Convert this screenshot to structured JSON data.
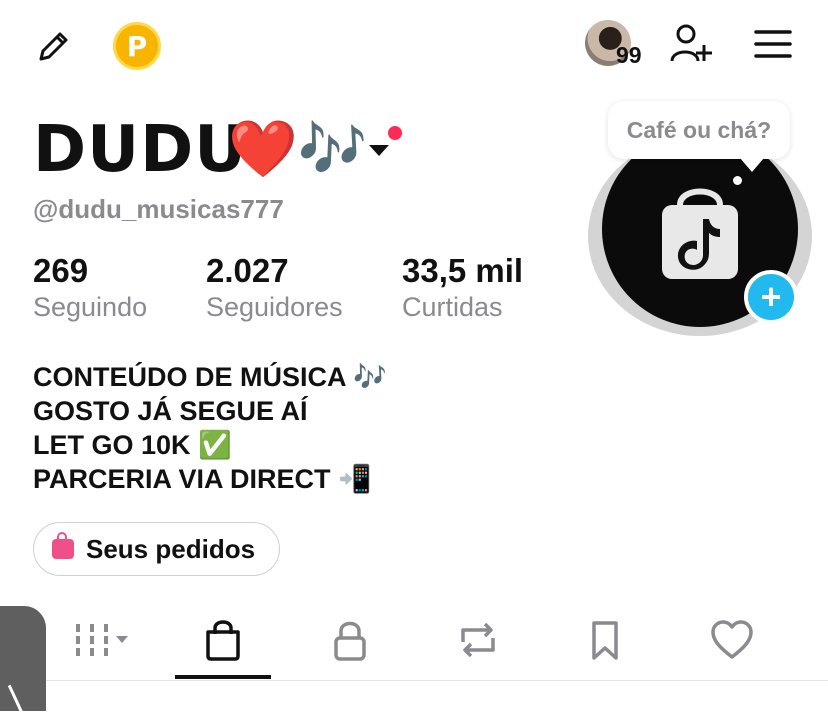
{
  "header": {
    "edit_icon": "pencil-icon",
    "coin_label": "P",
    "notification_count": "99",
    "add_friend_icon": "person-add-icon",
    "menu_icon": "hamburger-menu-icon"
  },
  "profile": {
    "name": "DUDU",
    "name_emoji": "❤️🎶",
    "username": "@dudu_musicas777",
    "tooltip": "Café ou chá?",
    "add_button": "+"
  },
  "stats": [
    {
      "value": "269",
      "label": "Seguindo"
    },
    {
      "value": "2.027",
      "label": "Seguidores"
    },
    {
      "value": "33,5 mil",
      "label": "Curtidas"
    }
  ],
  "bio": [
    "CONTEÚDO DE MÚSICA 🎶",
    "GOSTO JÁ SEGUE AÍ",
    "LET GO 10K ✅",
    "PARCERIA VIA DIRECT 📲"
  ],
  "orders_button": "Seus pedidos",
  "tabs": [
    {
      "icon": "grid-icon",
      "active": false
    },
    {
      "icon": "shopping-bag-icon",
      "active": true
    },
    {
      "icon": "lock-icon",
      "active": false
    },
    {
      "icon": "repost-icon",
      "active": false
    },
    {
      "icon": "bookmark-icon",
      "active": false
    },
    {
      "icon": "heart-icon",
      "active": false
    }
  ],
  "colors": {
    "accent_red": "#fe2c55",
    "plus_blue": "#21b9ee",
    "coin_gold": "#f7b500",
    "muted_text": "#8a8a8f"
  }
}
